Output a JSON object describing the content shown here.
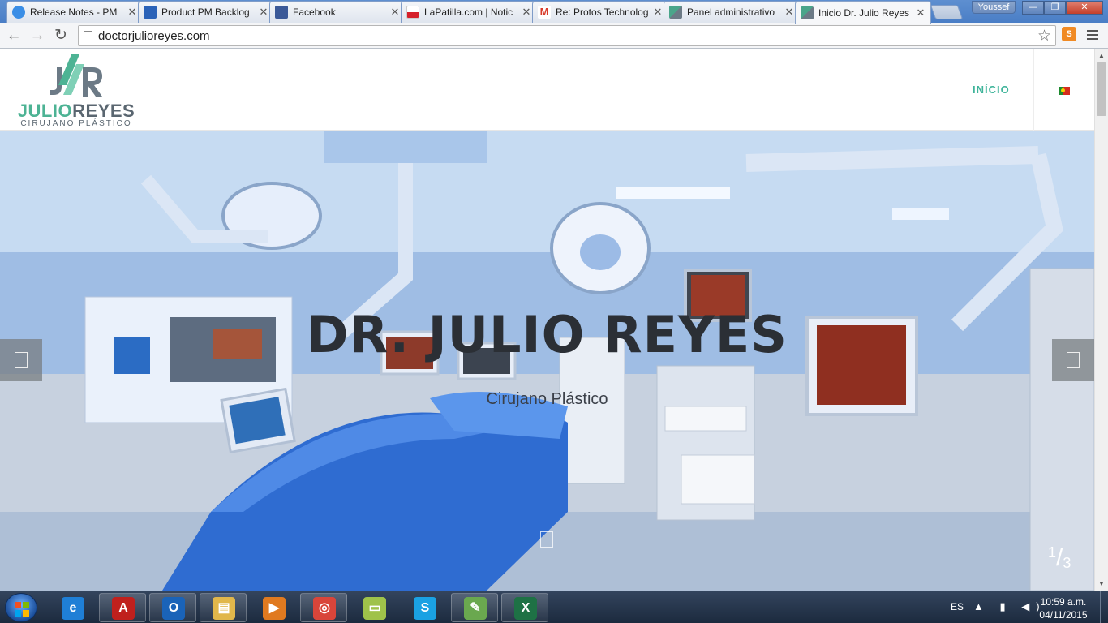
{
  "browser": {
    "tabs": [
      {
        "title": "Release Notes - PM",
        "favicon_color": "#3a8ee6",
        "active": false
      },
      {
        "title": "Product PM Backlog",
        "favicon_color": "#2a62b8",
        "active": false
      },
      {
        "title": "Facebook",
        "favicon_color": "#3b5998",
        "active": false
      },
      {
        "title": "LaPatilla.com | Notic",
        "favicon_color": "#d6202a",
        "active": false
      },
      {
        "title": "Re: Protos Technolog",
        "favicon_color": "#d93b2b",
        "active": false
      },
      {
        "title": "Panel administrativo",
        "favicon_color": "#4aa58a",
        "active": false
      },
      {
        "title": "Inicio Dr. Julio Reyes",
        "favicon_color": "#4aa58a",
        "active": true
      }
    ],
    "close_glyph": "✕",
    "user_name": "Youssef",
    "window_controls": {
      "minimize": "—",
      "maximize": "❐",
      "close": "✕"
    },
    "nav": {
      "back": "←",
      "forward": "→",
      "reload": "↻"
    },
    "url": "doctorjulioreyes.com",
    "star_glyph": "☆",
    "extension_label": "S"
  },
  "site": {
    "logo": {
      "first": "JULIO",
      "last": "REYES",
      "subtitle": "CIRUJANO PLÁSTICO"
    },
    "nav_inicio": "INÍCIO",
    "hero": {
      "title": "DR. JULIO REYES",
      "subtitle": "Cirujano Plástico",
      "current_slide": "1",
      "separator": "/",
      "total_slides": "3"
    }
  },
  "taskbar": {
    "apps": [
      {
        "name": "internet-explorer",
        "glyph": "e",
        "color": "#1f7fd6",
        "active": false
      },
      {
        "name": "acrobat",
        "glyph": "A",
        "color": "#c0201d",
        "active": true
      },
      {
        "name": "outlook",
        "glyph": "O",
        "color": "#1a63b8",
        "active": true
      },
      {
        "name": "file-explorer",
        "glyph": "▤",
        "color": "#e1b74b",
        "active": true
      },
      {
        "name": "media-player",
        "glyph": "▶",
        "color": "#e07a20",
        "active": false
      },
      {
        "name": "chrome",
        "glyph": "◎",
        "color": "#d9453a",
        "active": true
      },
      {
        "name": "notes",
        "glyph": "▭",
        "color": "#9fc24a",
        "active": false
      },
      {
        "name": "skype",
        "glyph": "S",
        "color": "#1aa1e3",
        "active": false
      },
      {
        "name": "editor",
        "glyph": "✎",
        "color": "#6aa84f",
        "active": true
      },
      {
        "name": "excel",
        "glyph": "X",
        "color": "#1e7145",
        "active": true
      }
    ],
    "language": "ES",
    "tray": "▲ ▮ ◀)",
    "time": "10:59 a.m.",
    "date": "04/11/2015"
  },
  "colors": {
    "accent_green": "#3fb49a",
    "logo_gray": "#5a6670"
  }
}
